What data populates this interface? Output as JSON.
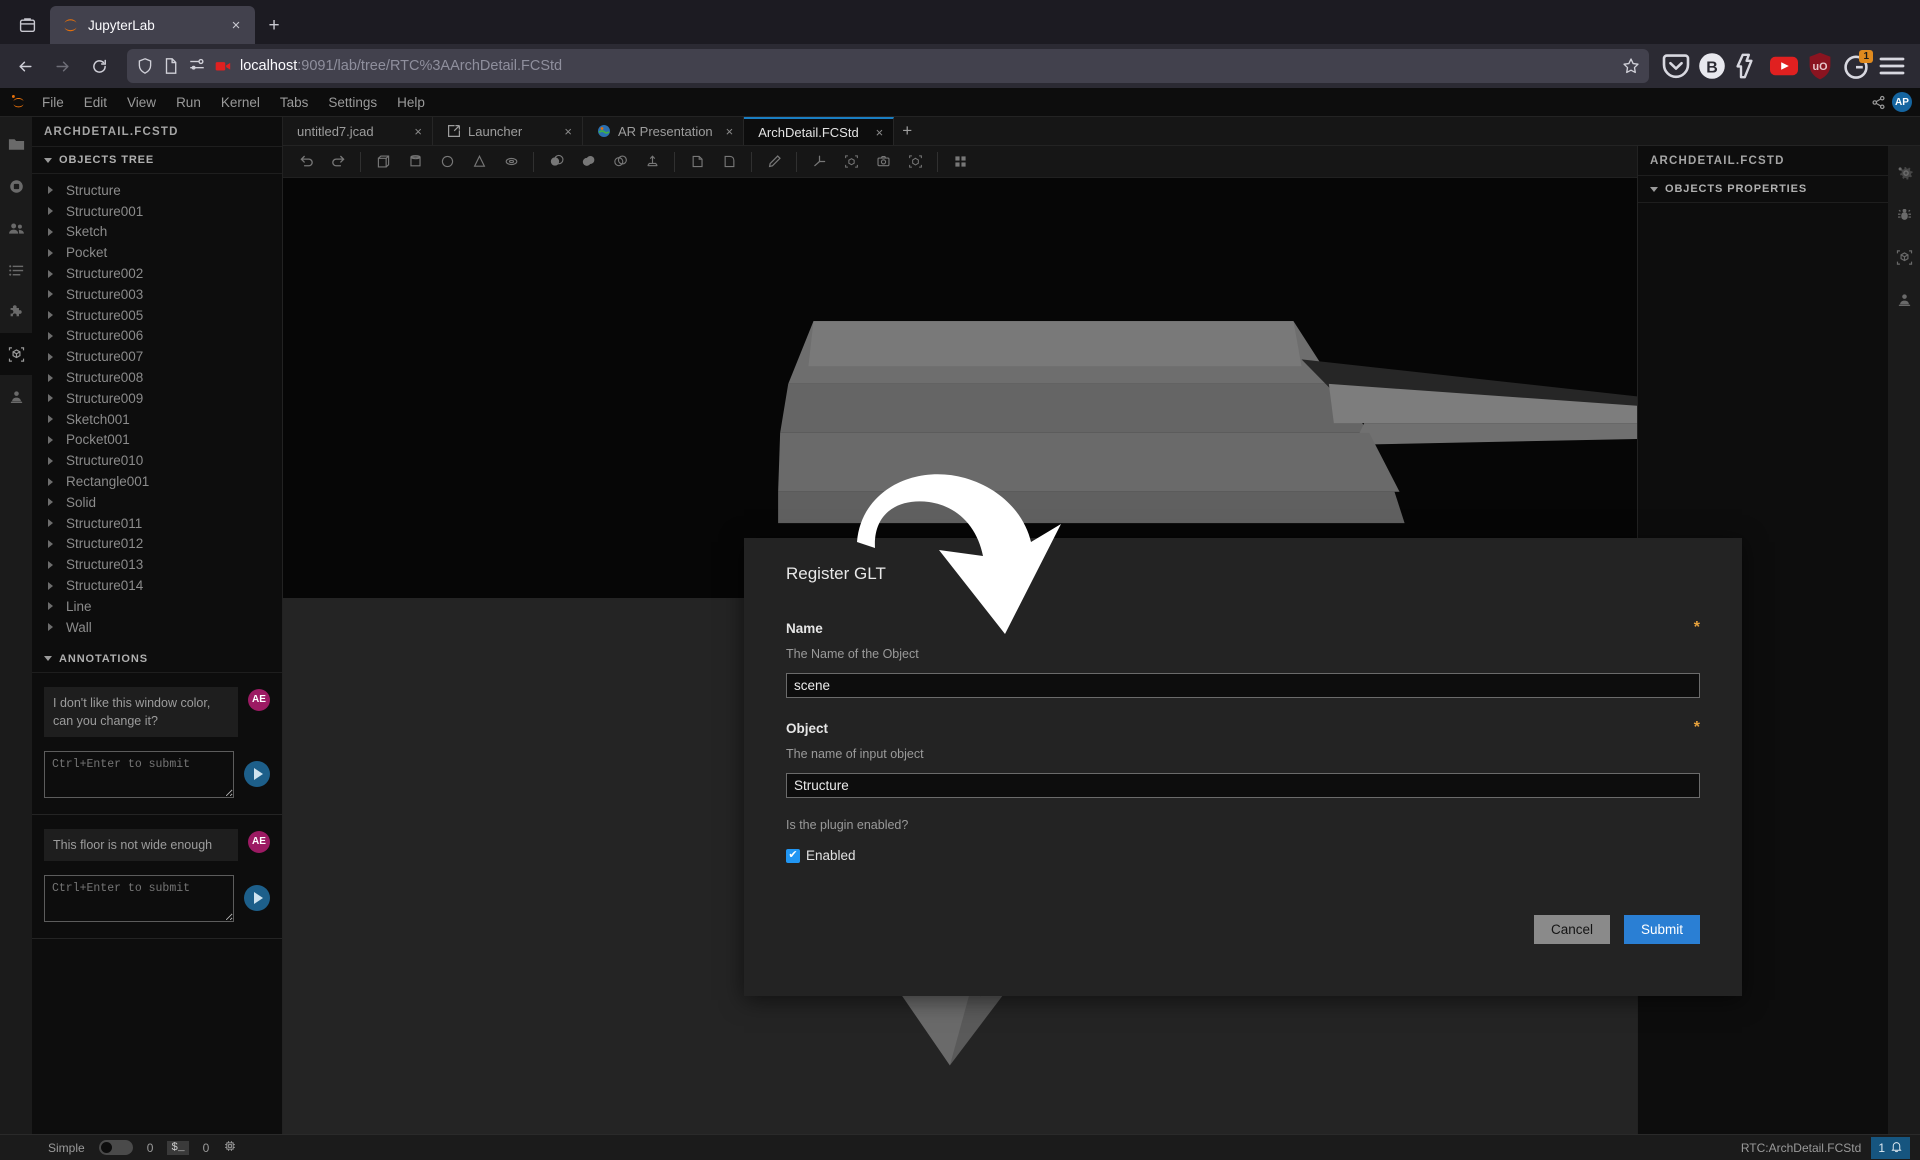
{
  "browser": {
    "tabs": [
      {
        "title": "JupyterLab",
        "favicon": "jupyter-icon",
        "active": true
      }
    ],
    "new_tab_label": "+",
    "close_label": "×",
    "url": {
      "host": "localhost",
      "rest": ":9091/lab/tree/RTC%3AArchDetail.FCStd"
    },
    "nav": {
      "back": "back-arrow",
      "forward": "forward-arrow",
      "reload": "reload-icon"
    },
    "extensions": [
      {
        "name": "pocket-icon"
      },
      {
        "name": "bitwarden-icon",
        "label": "B"
      },
      {
        "name": "privacy-badger-icon"
      },
      {
        "name": "youtube-downloader-icon"
      },
      {
        "name": "ublock-origin-icon",
        "label": "uO"
      },
      {
        "name": "grammarly-icon",
        "badge": "1"
      }
    ],
    "menu_label": "☰"
  },
  "jupyter": {
    "menus": [
      "File",
      "Edit",
      "View",
      "Run",
      "Kernel",
      "Tabs",
      "Settings",
      "Help"
    ],
    "avatar_initials": "AP",
    "left_activity_items": [
      "file-browser-icon",
      "running-terminals-icon",
      "collaboration-icon",
      "table-of-contents-icon",
      "extension-manager-icon",
      "cad-objects-icon",
      "annotations-icon"
    ],
    "right_activity_items": [
      "property-settings-icon",
      "debugger-icon",
      "cad-objects-icon",
      "annotations-icon"
    ],
    "left_panel": {
      "title": "ARCHDETAIL.FCSTD",
      "sections": [
        {
          "id": "objects-tree",
          "label": "OBJECTS TREE"
        },
        {
          "id": "annotations",
          "label": "ANNOTATIONS"
        }
      ],
      "objects_tree": [
        "Structure",
        "Structure001",
        "Sketch",
        "Pocket",
        "Structure002",
        "Structure003",
        "Structure005",
        "Structure006",
        "Structure007",
        "Structure008",
        "Structure009",
        "Sketch001",
        "Pocket001",
        "Structure010",
        "Rectangle001",
        "Solid",
        "Structure011",
        "Structure012",
        "Structure013",
        "Structure014",
        "Line",
        "Wall"
      ],
      "annotations": [
        {
          "message": "I don't like this window color, can you change it?",
          "author_initials": "AE",
          "reply_placeholder": "Ctrl+Enter to submit",
          "reply_value": ""
        },
        {
          "message": "This floor is not wide enough",
          "author_initials": "AE",
          "reply_placeholder": "Ctrl+Enter to submit",
          "reply_value": ""
        }
      ]
    },
    "right_panel": {
      "title": "ARCHDETAIL.FCSTD",
      "section_label": "OBJECTS PROPERTIES"
    },
    "document_tabs": [
      {
        "label": "untitled7.jcad",
        "icon": "jcad-file-icon",
        "active": false
      },
      {
        "label": "Launcher",
        "icon": "launcher-icon",
        "active": false
      },
      {
        "label": "AR Presentation",
        "icon": "ar-presentation-icon",
        "active": false
      },
      {
        "label": "ArchDetail.FCStd",
        "icon": "fcstd-file-icon",
        "active": true
      }
    ],
    "document_tab_add": "+",
    "viewer_toolbar": [
      "undo-icon",
      "redo-icon",
      "box-icon",
      "cylinder-icon",
      "sphere-icon",
      "cone-icon",
      "torus-icon",
      "cut-icon",
      "union-icon",
      "intersection-icon",
      "extrusion-icon",
      "sketch-icon",
      "chamfer-icon",
      "edit-icon",
      "axes-icon",
      "explode-icon",
      "screenshot-icon",
      "clip-plane-icon",
      "grid-icon"
    ],
    "statusbar": {
      "mode_label": "Simple",
      "mode_enabled": false,
      "kernel_count": "0",
      "terminal_icon_label": "$_",
      "terminal_count": "0",
      "memory_icon": "cpu-icon",
      "session_label": "RTC:ArchDetail.FCStd",
      "notification_count": "1",
      "notification_icon": "bell-icon"
    }
  },
  "dialog": {
    "title": "Register GLT",
    "fields": [
      {
        "label": "Name",
        "required_marker": "*",
        "help": "The Name of the Object",
        "value": "scene",
        "placeholder": ""
      },
      {
        "label": "Object",
        "required_marker": "*",
        "help": "The name of input object",
        "value": "Structure",
        "placeholder": ""
      }
    ],
    "checkbox": {
      "help": "Is the plugin enabled?",
      "label": "Enabled",
      "checked": true,
      "check_glyph": "✔"
    },
    "buttons": {
      "cancel": "Cancel",
      "submit": "Submit"
    },
    "colors": {
      "submit_bg": "#2a7fd4",
      "cancel_bg": "#8a8a8a",
      "required": "#e8a33d",
      "checkbox": "#2196f3"
    }
  },
  "annotation_overlay": {
    "arrow": "curved-arrow-pointing-down"
  }
}
